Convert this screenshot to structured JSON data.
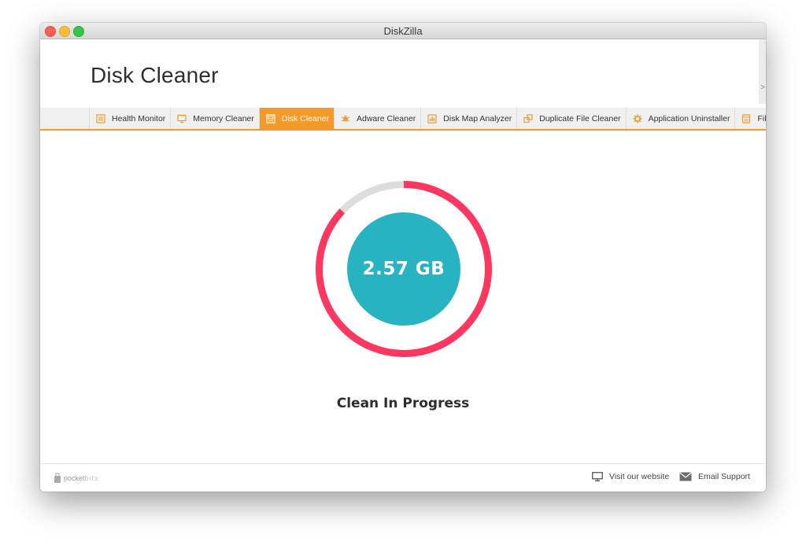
{
  "window": {
    "title": "DiskZilla"
  },
  "header": {
    "title": "Disk Cleaner"
  },
  "tabs": [
    {
      "label": "Health Monitor",
      "icon": "list-icon"
    },
    {
      "label": "Memory Cleaner",
      "icon": "monitor-icon"
    },
    {
      "label": "Disk Cleaner",
      "icon": "disk-icon",
      "active": true
    },
    {
      "label": "Adware Cleaner",
      "icon": "bug-icon"
    },
    {
      "label": "Disk Map Analyzer",
      "icon": "chart-icon"
    },
    {
      "label": "Duplicate File Cleaner",
      "icon": "duplicate-icon"
    },
    {
      "label": "Application Uninstaller",
      "icon": "gear-icon"
    },
    {
      "label": "File Shredder",
      "icon": "shredder-icon"
    }
  ],
  "main": {
    "size": "2.57 GB",
    "status": "Clean In Progress",
    "progress_percent": 87
  },
  "footer": {
    "brand_prefix": "pocket",
    "brand_suffix": "bits",
    "website_label": "Visit our website",
    "support_label": "Email Support"
  },
  "colors": {
    "accent": "#f39a2b",
    "progress": "#fd3760",
    "track": "#dddddd",
    "center": "#27b3c1"
  }
}
